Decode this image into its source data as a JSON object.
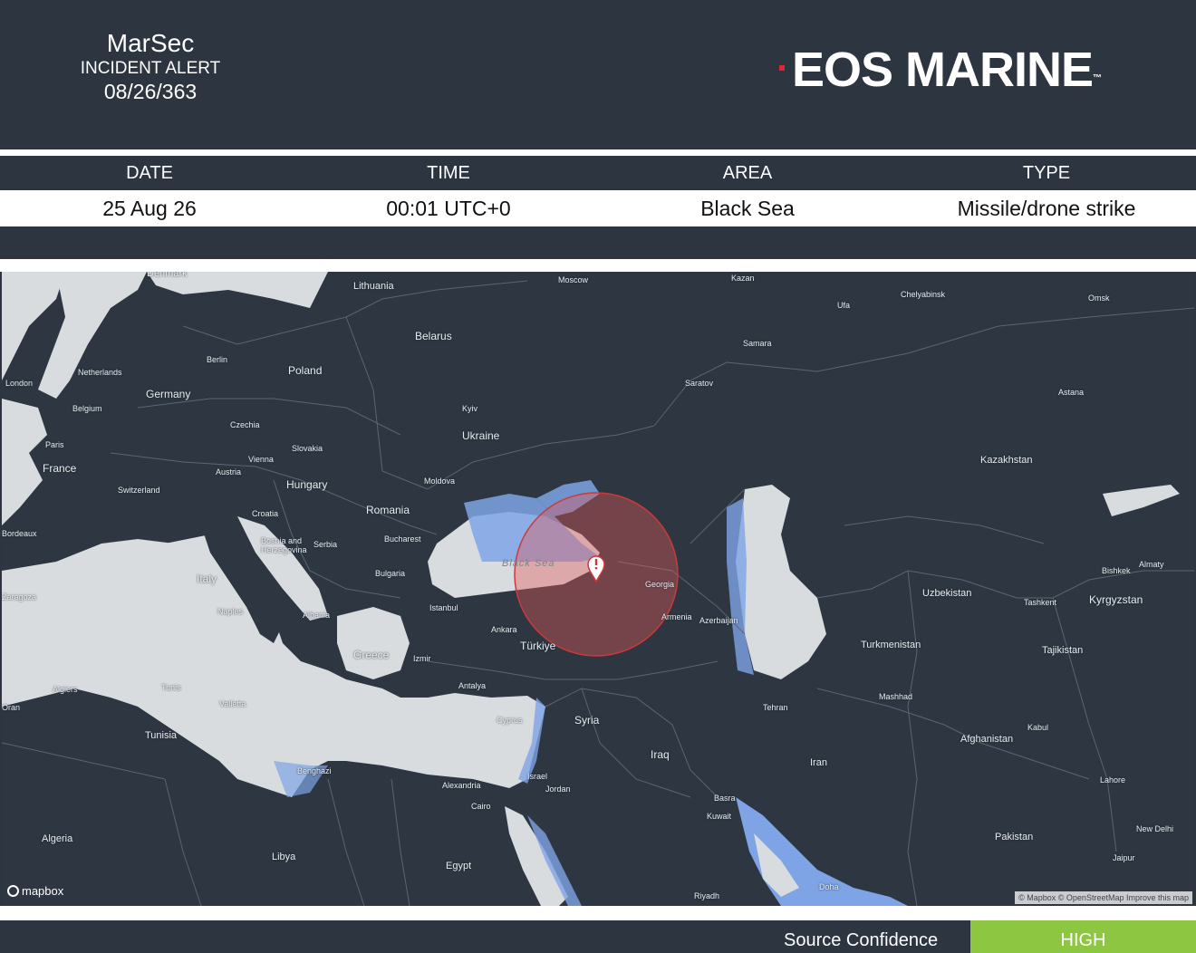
{
  "header": {
    "brand_line1": "MarSec",
    "brand_line2": "INCIDENT ALERT",
    "brand_line3": "08/26/363",
    "logo_text": "EOS MARINE",
    "logo_tm": "™"
  },
  "incident": {
    "columns": [
      "DATE",
      "TIME",
      "AREA",
      "TYPE"
    ],
    "values": [
      "25 Aug 26",
      "00:01 UTC+0",
      "Black Sea",
      "Missile/drone strike"
    ]
  },
  "map": {
    "labels": [
      "Denmark",
      "Lithuania",
      "Moscow",
      "Kazan",
      "Chelyabinsk",
      "Omsk",
      "Ufa",
      "Samara",
      "Belarus",
      "Berlin",
      "Netherlands",
      "London",
      "Poland",
      "Germany",
      "Belgium",
      "Saratov",
      "Astana",
      "Kyiv",
      "Czechia",
      "Ukraine",
      "Paris",
      "Slovakia",
      "Kazakhstan",
      "France",
      "Vienna",
      "Austria",
      "Moldova",
      "Switzerland",
      "Hungary",
      "Croatia",
      "Romania",
      "Bosnia and Herzegovina",
      "Serbia",
      "Bucharest",
      "Bulgaria",
      "Black Sea",
      "Georgia",
      "Italy",
      "Uzbekistan",
      "Bishkek",
      "Almaty",
      "Kyrgyzstan",
      "Tashkent",
      "Naples",
      "Albania",
      "Istanbul",
      "Armenia",
      "Azerbaijan",
      "Ankara",
      "Türkiye",
      "Turkmenistan",
      "Tajikistan",
      "Greece",
      "Izmir",
      "Algiers",
      "Tunis",
      "Antalya",
      "Valletta",
      "Mashhad",
      "Tehran",
      "Cyprus",
      "Syria",
      "Tunisia",
      "Kabul",
      "Afghanistan",
      "Iraq",
      "Iran",
      "Benghazi",
      "Israel",
      "Lahore",
      "Jordan",
      "Alexandria",
      "Cairo",
      "Basra",
      "Kuwait",
      "Algeria",
      "New Delhi",
      "Pakistan",
      "Libya",
      "Egypt",
      "Jaipur",
      "Riyadh",
      "Doha",
      "Oran",
      "Bordeaux",
      "Zaragoza"
    ],
    "provider": "mapbox",
    "attribution": "© Mapbox © OpenStreetMap Improve this map"
  },
  "footer": {
    "confidence_label": "Source Confidence",
    "confidence_value": "HIGH"
  },
  "colors": {
    "background": "#2c3540",
    "water": "#d9dcdf",
    "highlight_zone": "#7ea4e6",
    "incident_circle": "#e05a5a",
    "confidence_high": "#8dc641"
  }
}
